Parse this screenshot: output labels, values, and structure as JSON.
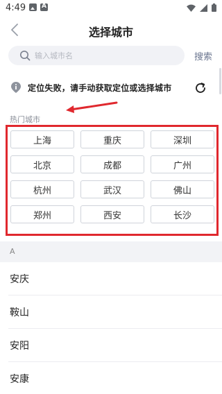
{
  "status_bar": {
    "time": "4:49",
    "left_icons": [
      "image-icon",
      "font-icon"
    ],
    "right_icons": [
      "wifi-icon",
      "cellular-icon",
      "battery-icon"
    ]
  },
  "header": {
    "title": "选择城市",
    "back_icon": "chevron-left-icon"
  },
  "search": {
    "placeholder": "输入城市名",
    "value": "",
    "button_label": "搜索",
    "icon": "search-icon"
  },
  "location": {
    "message": "定位失败，请手动获取定位或选择城市",
    "info_icon": "location-info-icon",
    "refresh_icon": "refresh-icon"
  },
  "hot_cities": {
    "label": "热门城市",
    "cities": [
      "上海",
      "重庆",
      "深圳",
      "北京",
      "成都",
      "广州",
      "杭州",
      "武汉",
      "佛山",
      "郑州",
      "西安",
      "长沙"
    ]
  },
  "city_index": {
    "letter": "A",
    "cities": [
      "安庆",
      "鞍山",
      "安阳",
      "安康"
    ]
  },
  "colors": {
    "annotation_red": "#e0282e",
    "search_bg": "#f1f2f6",
    "section_bg": "#f2f3f6",
    "muted_text": "#8b8f99"
  }
}
